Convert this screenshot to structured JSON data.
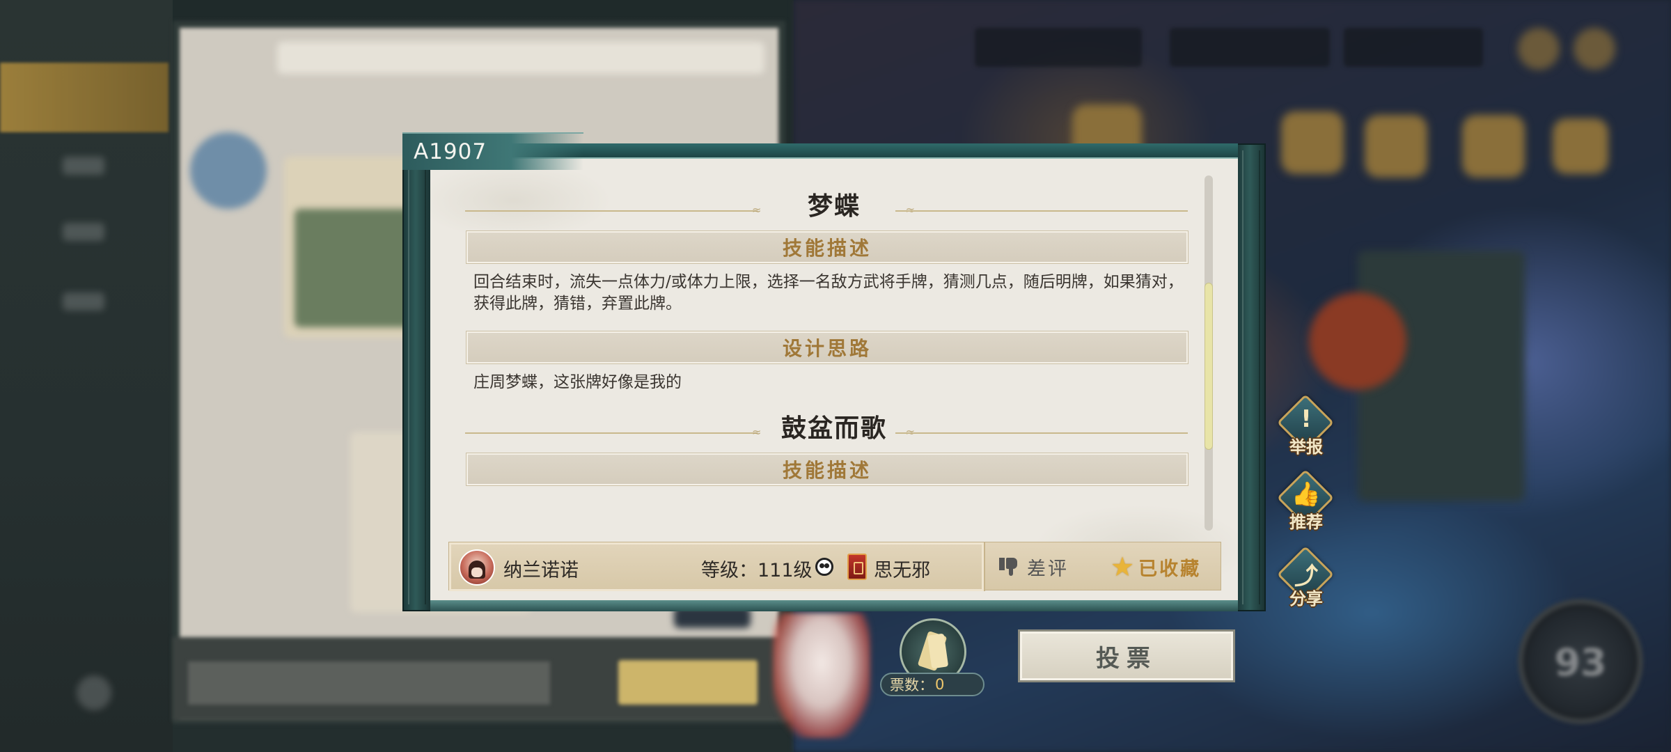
{
  "modal": {
    "tag": "A1907",
    "skills": [
      {
        "name": "梦蝶",
        "sections": [
          {
            "header": "技能描述",
            "text": "回合结束时，流失一点体力/或体力上限，选择一名敌方武将手牌，猜测几点，随后明牌，如果猜对，获得此牌，猜错，弃置此牌。"
          },
          {
            "header": "设计思路",
            "text": "庄周梦蝶，这张牌好像是我的"
          }
        ]
      },
      {
        "name": "鼓盆而歌",
        "sections": [
          {
            "header": "技能描述"
          }
        ]
      }
    ],
    "footer": {
      "author": "纳兰诺诺",
      "level": "等级：111级",
      "clan": "思无邪",
      "dislike_label": "差评",
      "favorite_label": "已收藏"
    }
  },
  "side_actions": [
    {
      "label": "举报",
      "icon": "warning-icon"
    },
    {
      "label": "推荐",
      "icon": "thumb-up-icon"
    },
    {
      "label": "分享",
      "icon": "share-icon"
    }
  ],
  "vote": {
    "count_label": "票数：",
    "count": "0",
    "button_label": "投票"
  },
  "background": {
    "dial_value": "93"
  },
  "colors": {
    "accent_gold": "#a07838",
    "frame_teal": "#2f5a58",
    "paper": "#ece9e2",
    "favorite_star": "#e8b43a"
  }
}
